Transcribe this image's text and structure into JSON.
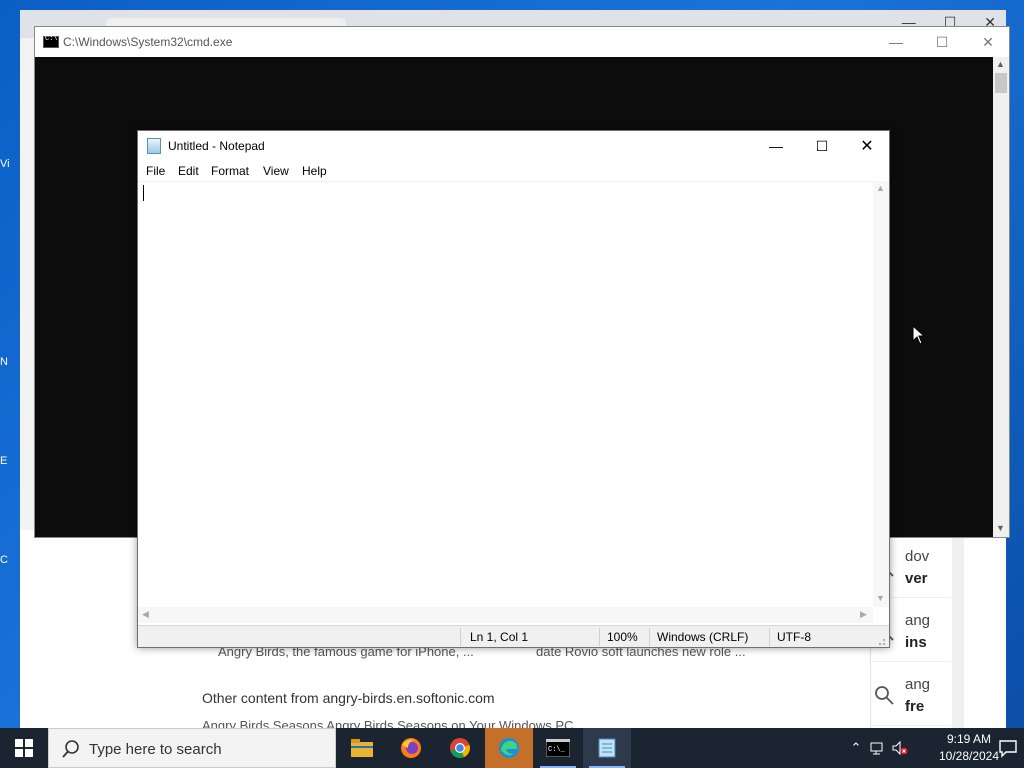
{
  "cmd": {
    "title": "C:\\Windows\\System32\\cmd.exe"
  },
  "notepad": {
    "title": "Untitled - Notepad",
    "menu": [
      "File",
      "Edit",
      "Format",
      "View",
      "Help"
    ],
    "content": "",
    "status": {
      "position": "Ln 1, Col 1",
      "zoom": "100%",
      "line_ending": "Windows (CRLF)",
      "encoding": "UTF-8"
    }
  },
  "browser": {
    "snippet_left": "Angry Birds, the famous game for iPhone, ...",
    "snippet_right": "date Rovio  soft launches  new role ...",
    "other_content": "Other content from angry-birds.en.softonic.com",
    "bottom_snippet": "Angry Birds Seasons Angry Birds Seasons on Your Windows PC",
    "side_results": [
      {
        "line1": "dov",
        "line2": "ver"
      },
      {
        "line1": "ang",
        "line2": "ins"
      },
      {
        "line1": "ang",
        "line2": "fre"
      }
    ]
  },
  "desktop_icons": [
    "Vi",
    "N",
    "E",
    "C"
  ],
  "taskbar": {
    "search_placeholder": "Type here to search",
    "apps": [
      {
        "name": "File Explorer",
        "icon": "folder-icon"
      },
      {
        "name": "Firefox",
        "icon": "firefox-icon"
      },
      {
        "name": "Chrome",
        "icon": "chrome-icon"
      },
      {
        "name": "Edge",
        "icon": "edge-icon"
      },
      {
        "name": "Command Prompt",
        "icon": "cmd-icon"
      },
      {
        "name": "Notepad",
        "icon": "notepad-icon"
      }
    ],
    "time": "9:19 AM",
    "date": "10/28/2024"
  },
  "colors": {
    "desktop": "#0b5fc4",
    "taskbar": "#1b2431",
    "active_app": "#c2702a",
    "cmd_bg": "#0c0c0c"
  }
}
